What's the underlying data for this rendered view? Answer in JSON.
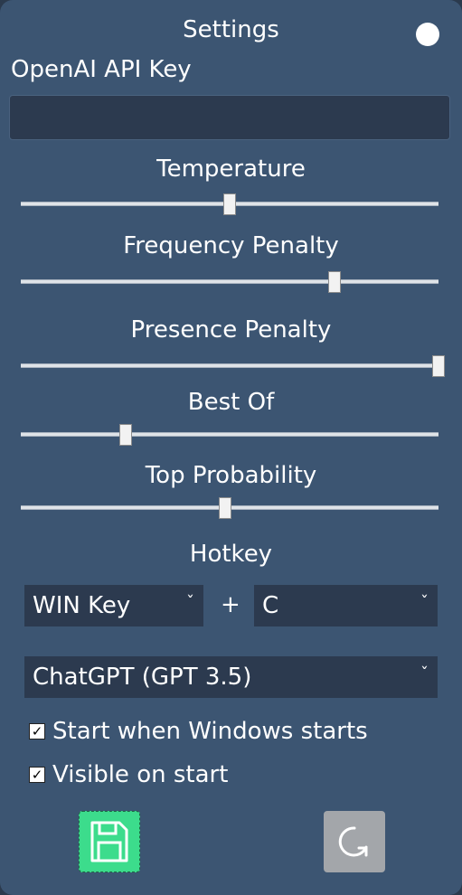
{
  "window": {
    "title": "Settings"
  },
  "api_key": {
    "label": "OpenAI API Key",
    "value": ""
  },
  "sliders": [
    {
      "label": "Temperature",
      "value_fraction": 0.5
    },
    {
      "label": "Frequency Penalty",
      "value_fraction": 0.75
    },
    {
      "label": "Presence Penalty",
      "value_fraction": 1.0
    },
    {
      "label": "Best Of",
      "value_fraction": 0.25
    },
    {
      "label": "Top Probability",
      "value_fraction": 0.49
    }
  ],
  "hotkey": {
    "label": "Hotkey",
    "modifier": "WIN Key",
    "plus": "+",
    "key": "C"
  },
  "model": {
    "selected": "ChatGPT (GPT 3.5)"
  },
  "checkboxes": [
    {
      "label": "Start when Windows starts",
      "checked": true
    },
    {
      "label": "Visible on start",
      "checked": true
    }
  ],
  "icons": {
    "save": "floppy-disk-icon",
    "reset": "refresh-icon",
    "chevron": "chevron-down-icon"
  },
  "colors": {
    "panel": "#3c5572",
    "save_button": "#3cdc8c",
    "reset_button": "#a3a6aa"
  }
}
